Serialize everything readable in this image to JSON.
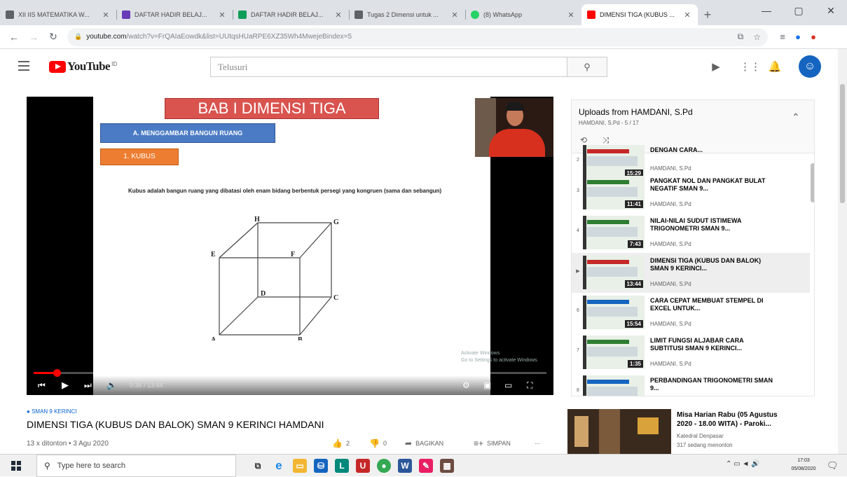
{
  "browser": {
    "tabs": [
      {
        "title": "XII IIS MATEMATIKA W...",
        "favicon_color": "#5f6368",
        "active": false
      },
      {
        "title": "DAFTAR HADIR BELAJ...",
        "favicon_color": "#673ab7",
        "active": false
      },
      {
        "title": "DAFTAR HADIR BELAJ...",
        "favicon_color": "#0f9d58",
        "active": false
      },
      {
        "title": "Tugas 2 Dimensi untuk ...",
        "favicon_color": "#5f6368",
        "active": false
      },
      {
        "title": "(8) WhatsApp",
        "favicon_color": "#25d366",
        "active": false
      },
      {
        "title": "DIMENSI TIGA (KUBUS ...",
        "favicon_color": "#ff0000",
        "active": true
      }
    ],
    "url_host": "youtube.com",
    "url_path": "/watch?v=FrQAIaEowdk&list=UUtqsHUaRPE6XZ35Wh4MwejeBindex=5"
  },
  "youtube": {
    "logo_text": "YouTube",
    "logo_cc": "ID",
    "search_placeholder": "Telusuri"
  },
  "video": {
    "slide_title": "BAB I DIMENSI TIGA",
    "slide_subtitle": "A. MENGGAMBAR BANGUN RUANG",
    "slide_section": "1. KUBUS",
    "slide_text": "Kubus adalah bangun ruang yang dibatasi oleh enam bidang berbentuk persegi yang kongruen (sama dan sebangun)",
    "cube_labels": [
      "A",
      "B",
      "C",
      "D",
      "E",
      "F",
      "G",
      "H"
    ],
    "watermark": "Activate Windows\nGo to Settings to activate Windows.",
    "time": "0:36 / 13:44",
    "progress": 0.045,
    "channel_tag": "SMAN 9 KERINCI",
    "title": "DIMENSI TIGA (KUBUS DAN BALOK) SMAN 9 KERINCI HAMDANI",
    "meta": "13 x ditonton • 3 Agu 2020",
    "likes": "2",
    "dislikes": "0",
    "share_label": "BAGIKAN",
    "save_label": "SIMPAN",
    "more_label": "..."
  },
  "playlist": {
    "title": "Uploads from HAMDANI, S.Pd",
    "subtitle": "HAMDANI, S.Pd - 5 / 17",
    "items": [
      {
        "index": "2",
        "title": "DENGAN CARA...",
        "channel": "HAMDANI, S.Pd",
        "duration": "15:29",
        "accent": "#c62828"
      },
      {
        "index": "3",
        "title": "PANGKAT NOL DAN PANGKAT BULAT NEGATIF SMAN 9...",
        "channel": "HAMDANI, S.Pd",
        "duration": "11:41",
        "accent": "#2e7d32"
      },
      {
        "index": "4",
        "title": "NILAI-NILAI SUDUT ISTIMEWA TRIGONOMETRI SMAN 9...",
        "channel": "HAMDANI, S.Pd",
        "duration": "7:43",
        "accent": "#2e7d32"
      },
      {
        "index": "▶",
        "title": "DIMENSI TIGA (KUBUS DAN BALOK) SMAN 9 KERINCI...",
        "channel": "HAMDANI, S.Pd",
        "duration": "13:44",
        "accent": "#c62828"
      },
      {
        "index": "6",
        "title": "CARA CEPAT MEMBUAT STEMPEL DI EXCEL UNTUK...",
        "channel": "HAMDANI, S.Pd",
        "duration": "15:54",
        "accent": "#1565c0"
      },
      {
        "index": "7",
        "title": "LIMIT FUNGSI ALJABAR CARA SUBTITUSI SMAN 9 KERINCI...",
        "channel": "HAMDANI, S.Pd",
        "duration": "1:35",
        "accent": "#2e7d32"
      },
      {
        "index": "8",
        "title": "PERBANDINGAN TRIGONOMETRI SMAN 9...",
        "channel": "",
        "duration": "",
        "accent": "#1565c0"
      }
    ]
  },
  "recommended": {
    "title": "Misa Harian Rabu (05 Agustus 2020 - 18.00 WITA) - Paroki...",
    "channel": "Katedral Denpasar",
    "live": "317 sedang menonton"
  },
  "taskbar": {
    "search_placeholder": "Type here to search",
    "time": "17:03",
    "date": "05/08/2020"
  }
}
